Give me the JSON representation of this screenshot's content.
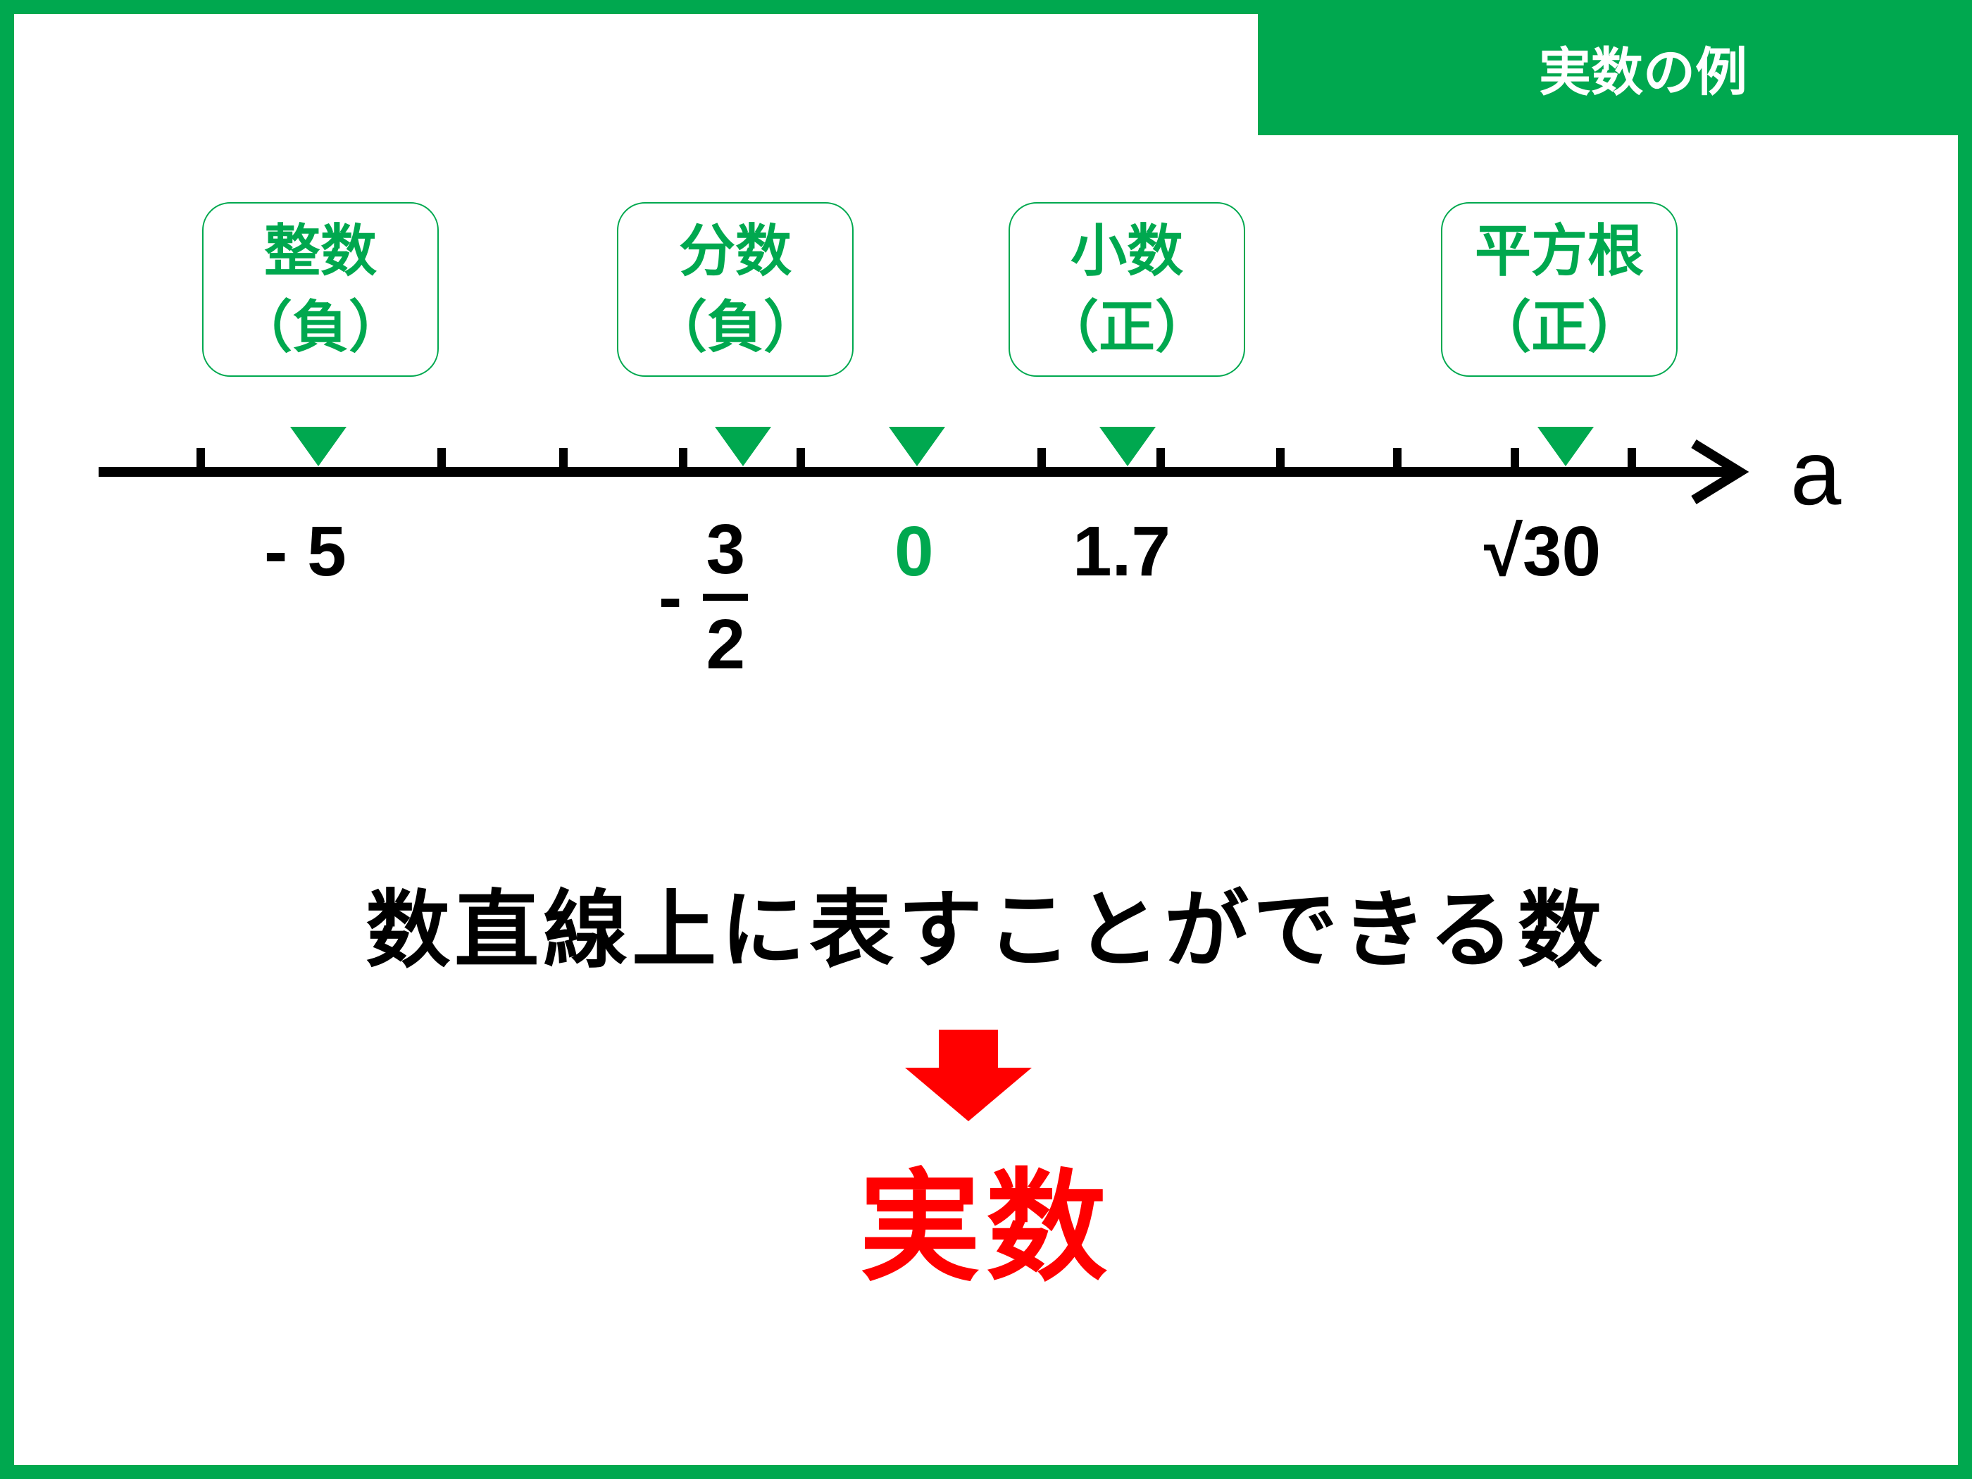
{
  "title": "実数の例",
  "categories": [
    {
      "line1": "整数",
      "line2": "（負）"
    },
    {
      "line1": "分数",
      "line2": "（負）"
    },
    {
      "line1": "小数",
      "line2": "（正）"
    },
    {
      "line1": "平方根",
      "line2": "（正）"
    }
  ],
  "number_line": {
    "variable": "a",
    "values": [
      {
        "text": "- 5",
        "color": "#000000"
      },
      {
        "minus": "-",
        "numerator": "3",
        "denominator": "2"
      },
      {
        "text": "0",
        "color": "#00A84F"
      },
      {
        "text": "1.7",
        "color": "#000000"
      },
      {
        "text": "√30",
        "color": "#000000"
      }
    ]
  },
  "statement": "数直線上に表すことができる数",
  "result": "実数",
  "colors": {
    "accent": "#00A84F",
    "highlight": "#FF0000",
    "text": "#000000"
  },
  "icons": {
    "marker": "down-triangle-icon",
    "arrow": "down-arrow-icon"
  }
}
